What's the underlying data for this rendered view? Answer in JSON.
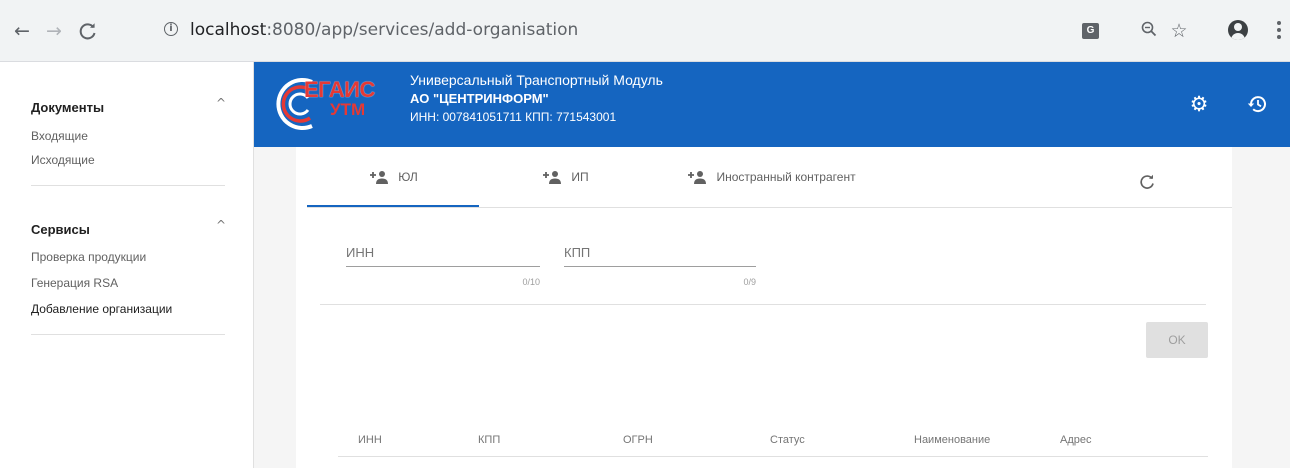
{
  "browser": {
    "url_host": "localhost",
    "url_rest": ":8080/app/services/add-organisation"
  },
  "sidebar": {
    "sections": [
      {
        "title": "Документы",
        "items": [
          "Входящие",
          "Исходящие"
        ]
      },
      {
        "title": "Сервисы",
        "items": [
          "Проверка продукции",
          "Генерация RSA",
          "Добавление организации"
        ]
      }
    ],
    "active_item": "Добавление организации"
  },
  "header": {
    "logo_top": "ЕГАИС",
    "logo_bottom": "УТМ",
    "app_title": "Универсальный Транспортный Модуль",
    "org_name": "АО \"ЦЕНТРИНФОРМ\"",
    "org_ids": "ИНН: 007841051711 КПП: 771543001",
    "colors": {
      "primary": "#1565c0",
      "logo_red": "#e53935"
    }
  },
  "tabs": [
    {
      "label": "ЮЛ",
      "icon": "person-add-icon",
      "active": true
    },
    {
      "label": "ИП",
      "icon": "person-add-icon",
      "active": false
    },
    {
      "label": "Иностранный контрагент",
      "icon": "person-add-icon",
      "active": false
    }
  ],
  "form": {
    "inn": {
      "label": "ИНН",
      "value": "",
      "counter": "0/10"
    },
    "kpp": {
      "label": "КПП",
      "value": "",
      "counter": "0/9"
    },
    "ok_label": "OK"
  },
  "table": {
    "columns": [
      "ИНН",
      "КПП",
      "ОГРН",
      "Статус",
      "Наименование",
      "Адрес"
    ]
  }
}
